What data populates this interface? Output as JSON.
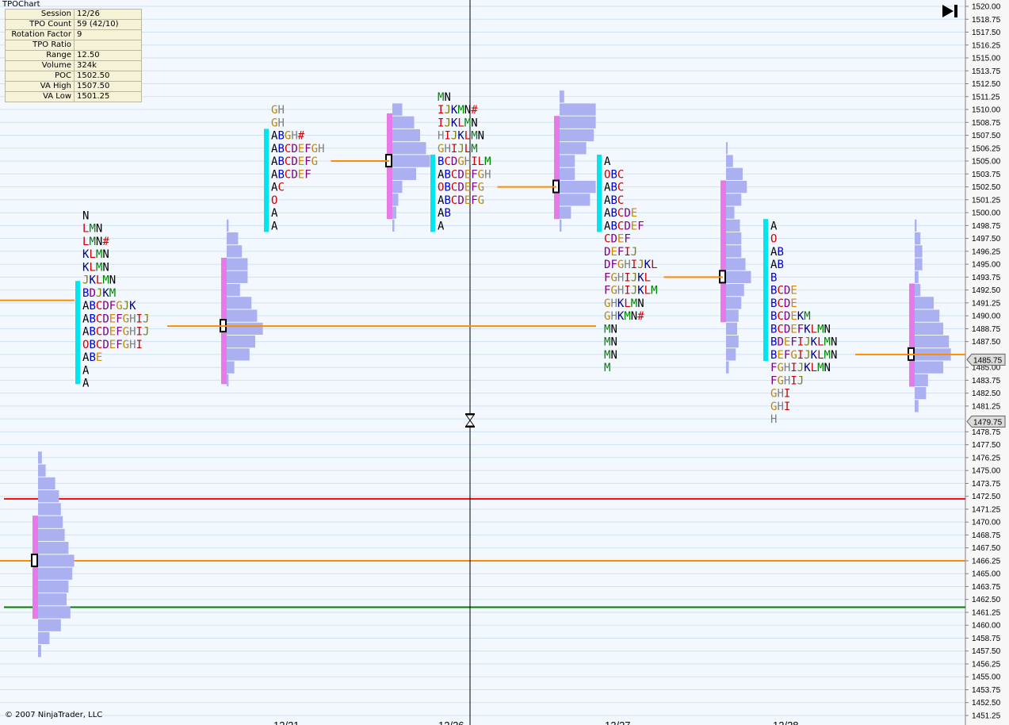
{
  "app": {
    "title": "TPOChart",
    "copyright": "© 2007 NinjaTrader, LLC"
  },
  "info": [
    {
      "label": "Session",
      "value": "12/26"
    },
    {
      "label": "TPO Count",
      "value": "59 (42/10)"
    },
    {
      "label": "Rotation Factor",
      "value": "9"
    },
    {
      "label": "TPO Ratio",
      "value": ""
    },
    {
      "label": "Range",
      "value": "12.50"
    },
    {
      "label": "Volume",
      "value": "324k"
    },
    {
      "label": "POC",
      "value": "1502.50"
    },
    {
      "label": "VA High",
      "value": "1507.50"
    },
    {
      "label": "VA Low",
      "value": "1501.25"
    }
  ],
  "icons": {
    "end": "skip-to-end-icon",
    "cursor": "hourglass-icon"
  },
  "chart_data": {
    "type": "tpo_profile",
    "ylim": [
      1451.25,
      1520.0
    ],
    "tick_step": 1.25,
    "tick_labels": [
      "1520.00",
      "1518.75",
      "1517.50",
      "1516.25",
      "1515.00",
      "1513.75",
      "1512.50",
      "1511.25",
      "1510.00",
      "1508.75",
      "1507.50",
      "1506.25",
      "1505.00",
      "1503.75",
      "1502.50",
      "1501.25",
      "1500.00",
      "1498.75",
      "1497.50",
      "1496.25",
      "1495.00",
      "1493.75",
      "1492.50",
      "1491.25",
      "1490.00",
      "1488.75",
      "1487.50",
      "1485.00",
      "1483.75",
      "1482.50",
      "1481.25",
      "1478.75",
      "1477.50",
      "1476.25",
      "1475.00",
      "1473.75",
      "1472.50",
      "1471.25",
      "1470.00",
      "1468.75",
      "1467.50",
      "1466.25",
      "1465.00",
      "1463.75",
      "1462.50",
      "1461.25",
      "1460.00",
      "1458.75",
      "1457.50",
      "1456.25",
      "1455.00",
      "1453.75",
      "1452.50",
      "1451.25"
    ],
    "x_labels": [
      "12/21",
      "12/26",
      "12/27",
      "12/28"
    ],
    "price_markers": [
      {
        "value": 1485.75,
        "label": "1485.75"
      },
      {
        "value": 1479.75,
        "label": "1479.75"
      }
    ],
    "levels": [
      {
        "value": 1472.25,
        "color": "#ff0000"
      },
      {
        "value": 1466.25,
        "color": "#ff8c00"
      },
      {
        "value": 1461.75,
        "color": "#008000"
      }
    ],
    "colors": {
      "va_bar": "#00e5ee",
      "profile_bar": "#aab0f0",
      "profile_va": "#e879e8",
      "poc_line": "#ff8c00",
      "gridline": "#cfe2f3",
      "letter_colors": {
        "A": "#000000",
        "B": "#0000cc",
        "C": "#cc0000",
        "D": "#800080",
        "E": "#cc8800",
        "F": "#800080",
        "G": "#b8860b",
        "H": "#808080",
        "I": "#cc0000",
        "J": "#808000",
        "K": "#000080",
        "L": "#cc0000",
        "M": "#008000",
        "N": "#000000",
        "O": "#cc0000",
        "#": "#cc0000"
      }
    },
    "letter_profiles": [
      {
        "name": "session-12-21",
        "top": 1499.75,
        "poc": 1489.0,
        "va_high": 1492.75,
        "va_low": 1484.0,
        "rows": [
          "N",
          "LMN",
          "LMN#",
          "KLMN",
          "KLMN",
          "JKLMN",
          "BDJKM",
          "ABCDFGJK",
          "ABCDEFGHIJ",
          "ABCDEFGHIJ",
          "OBCDEFGHI",
          "ABE",
          "A",
          "A"
        ]
      },
      {
        "name": "session-12-22",
        "top": 1510.0,
        "poc": 1505.0,
        "va_high": 1507.5,
        "va_low": 1498.75,
        "rows": [
          "GH",
          "GH",
          "ABGH#",
          "ABCDEFGH",
          "ABCDEFG",
          "ABCDEF",
          "AC",
          "O",
          "A",
          "A"
        ]
      },
      {
        "name": "session-12-26",
        "top": 1511.25,
        "poc": 1502.5,
        "va_high": 1505.0,
        "va_low": 1498.75,
        "rows": [
          "MN",
          "IJKMN#",
          "IJKLMN",
          "HIJKLMN",
          "GHIJLM",
          "BCDGHILM",
          "ABCDEFGH",
          "OBCDEFG",
          "ABCDEFG",
          "AB",
          "A"
        ]
      },
      {
        "name": "session-12-27",
        "top": 1505.0,
        "poc": 1493.75,
        "va_high": 1505.0,
        "va_low": 1498.75,
        "rows": [
          "A",
          "OBC",
          "ABC",
          "ABC",
          "ABCDE",
          "ABCDEF",
          "CDEF",
          "DEFIJ",
          "DFGHIJKL",
          "FGHIJKL",
          "FGHIJKLM",
          "GHKLMN",
          "GHKMN#",
          "MN",
          "MN",
          "MN",
          "M"
        ]
      },
      {
        "name": "session-12-28",
        "top": 1498.75,
        "poc": 1486.25,
        "va_high": 1498.75,
        "va_low": 1486.25,
        "rows": [
          "A",
          "O",
          "AB",
          "AB",
          "B",
          "BCDE",
          "BCDE",
          "BCDEKM",
          "BCDEFKLMN",
          "BDEFIJKLMN",
          "BEFGIJKLMN",
          "FGHIJKLMN",
          "FGHIJ",
          "GHI",
          "GHI",
          "H"
        ]
      }
    ],
    "volume_profiles": [
      {
        "name": "volume-12-20",
        "poc": 1466.25,
        "va_high": 1470.0,
        "va_low": 1461.25,
        "levels": [
          [
            1476.25,
            0.1
          ],
          [
            1475.0,
            0.2
          ],
          [
            1473.75,
            0.45
          ],
          [
            1472.5,
            0.55
          ],
          [
            1471.25,
            0.6
          ],
          [
            1470.0,
            0.65
          ],
          [
            1468.75,
            0.7
          ],
          [
            1467.5,
            0.8
          ],
          [
            1466.25,
            0.95
          ],
          [
            1465.0,
            0.9
          ],
          [
            1463.75,
            0.8
          ],
          [
            1462.5,
            0.75
          ],
          [
            1461.25,
            0.85
          ],
          [
            1460.0,
            0.6
          ],
          [
            1458.75,
            0.3
          ],
          [
            1457.5,
            0.08
          ]
        ]
      },
      {
        "name": "volume-12-21",
        "poc": 1489.0,
        "va_high": 1495.0,
        "va_low": 1484.0,
        "levels": [
          [
            1498.75,
            0.05
          ],
          [
            1497.5,
            0.3
          ],
          [
            1496.25,
            0.4
          ],
          [
            1495.0,
            0.55
          ],
          [
            1493.75,
            0.55
          ],
          [
            1492.5,
            0.35
          ],
          [
            1491.25,
            0.65
          ],
          [
            1490.0,
            0.8
          ],
          [
            1488.75,
            0.95
          ],
          [
            1487.5,
            0.75
          ],
          [
            1486.25,
            0.6
          ],
          [
            1485.0,
            0.2
          ],
          [
            1483.75,
            0.05
          ]
        ]
      },
      {
        "name": "volume-12-22",
        "poc": 1505.0,
        "va_high": 1509.0,
        "va_low": 1500.0,
        "levels": [
          [
            1510.0,
            0.25
          ],
          [
            1508.75,
            0.55
          ],
          [
            1507.5,
            0.7
          ],
          [
            1506.25,
            0.85
          ],
          [
            1505.0,
            0.95
          ],
          [
            1503.75,
            0.6
          ],
          [
            1502.5,
            0.25
          ],
          [
            1501.25,
            0.15
          ],
          [
            1500.0,
            0.1
          ],
          [
            1498.75,
            0.05
          ]
        ]
      },
      {
        "name": "volume-12-26",
        "poc": 1502.5,
        "va_high": 1508.75,
        "va_low": 1500.0,
        "levels": [
          [
            1511.25,
            0.12
          ],
          [
            1510.0,
            0.95
          ],
          [
            1508.75,
            0.95
          ],
          [
            1507.5,
            0.9
          ],
          [
            1506.25,
            0.7
          ],
          [
            1505.0,
            0.4
          ],
          [
            1503.75,
            0.4
          ],
          [
            1502.5,
            0.95
          ],
          [
            1501.25,
            0.8
          ],
          [
            1500.0,
            0.3
          ],
          [
            1498.75,
            0.05
          ]
        ]
      },
      {
        "name": "volume-12-27",
        "poc": 1493.75,
        "va_high": 1502.5,
        "va_low": 1490.0,
        "levels": [
          [
            1506.25,
            0.05
          ],
          [
            1505.0,
            0.25
          ],
          [
            1503.75,
            0.6
          ],
          [
            1502.5,
            0.75
          ],
          [
            1501.25,
            0.55
          ],
          [
            1500.0,
            0.3
          ],
          [
            1498.75,
            0.5
          ],
          [
            1497.5,
            0.55
          ],
          [
            1496.25,
            0.55
          ],
          [
            1495.0,
            0.7
          ],
          [
            1493.75,
            0.9
          ],
          [
            1492.5,
            0.65
          ],
          [
            1491.25,
            0.55
          ],
          [
            1490.0,
            0.45
          ],
          [
            1488.75,
            0.4
          ],
          [
            1487.5,
            0.45
          ],
          [
            1486.25,
            0.35
          ],
          [
            1485.0,
            0.1
          ]
        ]
      },
      {
        "name": "volume-12-28",
        "poc": 1486.25,
        "va_high": 1492.5,
        "va_low": 1483.75,
        "levels": [
          [
            1498.75,
            0.05
          ],
          [
            1497.5,
            0.15
          ],
          [
            1496.25,
            0.2
          ],
          [
            1495.0,
            0.2
          ],
          [
            1493.75,
            0.1
          ],
          [
            1492.5,
            0.15
          ],
          [
            1491.25,
            0.5
          ],
          [
            1490.0,
            0.65
          ],
          [
            1488.75,
            0.75
          ],
          [
            1487.5,
            0.9
          ],
          [
            1486.25,
            0.95
          ],
          [
            1485.0,
            0.75
          ],
          [
            1483.75,
            0.35
          ],
          [
            1482.5,
            0.3
          ],
          [
            1481.25,
            0.1
          ]
        ]
      }
    ]
  }
}
